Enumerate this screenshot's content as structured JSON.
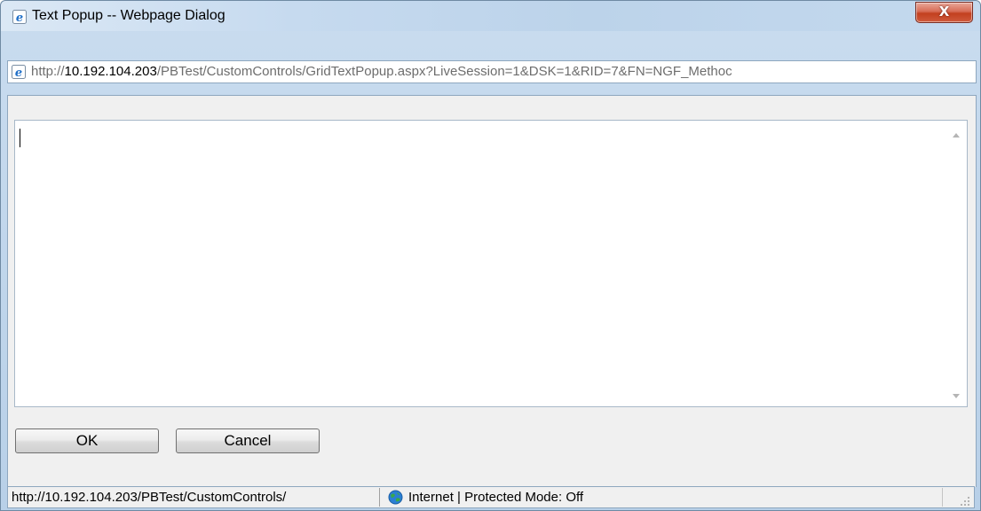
{
  "window": {
    "title": "Text Popup -- Webpage Dialog",
    "close_label": "X"
  },
  "address": {
    "host": "http://10.192.104.203",
    "path": "/PBTest/CustomControls/GridTextPopup.aspx?LiveSession=1&DSK=1&RID=7&FN=NGF_Methoc"
  },
  "editor": {
    "value": ""
  },
  "buttons": {
    "ok_label": "OK",
    "cancel_label": "Cancel"
  },
  "status": {
    "url": "http://10.192.104.203/PBTest/CustomControls/",
    "zone": "Internet | Protected Mode: Off"
  },
  "icons": {
    "browser": "ie-icon",
    "zone": "globe-icon",
    "grip": "resize-grip-icon"
  },
  "colors": {
    "title_gradient": "#c6daef",
    "close_red": "#c2401f",
    "border": "#8ea7bf"
  }
}
